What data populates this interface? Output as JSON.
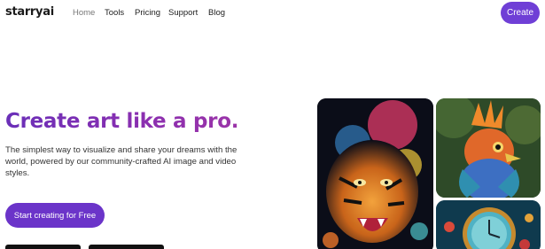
{
  "header": {
    "logo": "starryai",
    "nav": [
      {
        "label": "Home",
        "active": true
      },
      {
        "label": "Tools",
        "active": false
      },
      {
        "label": "Pricing",
        "active": false
      },
      {
        "label": "Support",
        "active": false
      },
      {
        "label": "Blog",
        "active": false
      }
    ],
    "create_label": "Create"
  },
  "hero": {
    "title": "Create art like a pro.",
    "subtitle": "The simplest way to visualize and share your dreams with the world, powered by our community-crafted AI image and video styles.",
    "cta_label": "Start creating for Free"
  },
  "colors": {
    "accent": "#6f3fd6",
    "title_gradient_start": "#6a2fb8",
    "title_gradient_end": "#9b34a8"
  },
  "gallery": [
    {
      "subject": "tiger-artwork"
    },
    {
      "subject": "bird-artwork"
    },
    {
      "subject": "clock-artwork"
    }
  ]
}
